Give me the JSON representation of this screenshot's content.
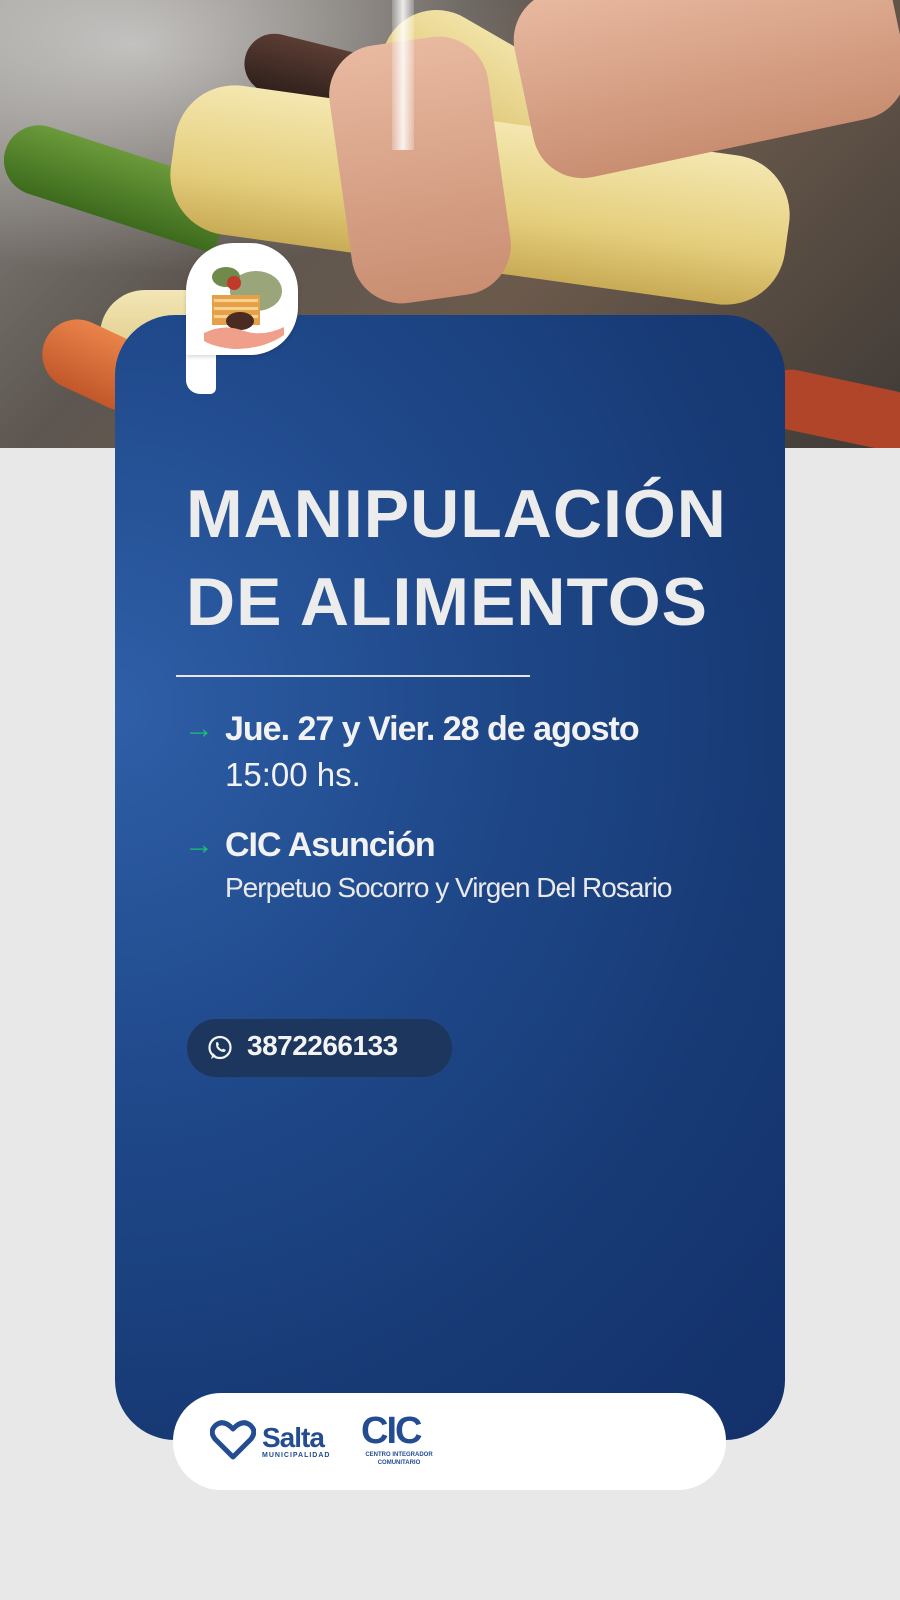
{
  "photo": {
    "description_icon": "vegetables-photo"
  },
  "event": {
    "title_line1": "MANIPULACIÓN",
    "title_line2": "DE  ALIMENTOS",
    "date": "Jue. 27 y Vier. 28 de agosto",
    "time": "15:00 hs.",
    "place": "CIC Asunción",
    "address": "Perpetuo Socorro y Virgen Del Rosario",
    "arrow_symbol": "→"
  },
  "contact": {
    "icon": "whatsapp-icon",
    "phone": "3872266133"
  },
  "footer": {
    "salta": "Salta",
    "salta_sub": "MUNICIPALIDAD",
    "cic": "CIC",
    "cic_sub_line1": "CENTRO INTEGRADOR",
    "cic_sub_line2": "COMUNITARIO"
  },
  "colors": {
    "card_blue": "#204a8c",
    "accent_green": "#1dbf73",
    "brand_blue": "#234c91",
    "page_bg": "#e8e8e8"
  }
}
